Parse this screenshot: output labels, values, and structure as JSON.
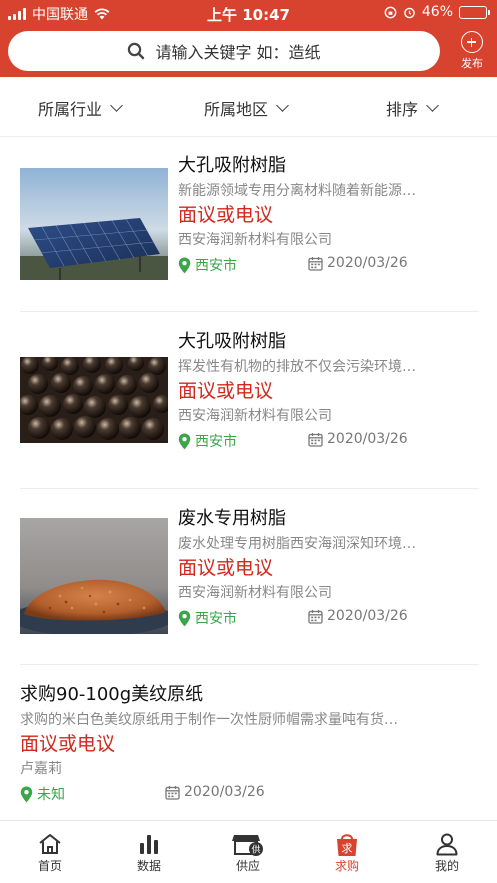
{
  "status_bar": {
    "carrier": "中国联通",
    "time": "上午 10:47",
    "battery": "46%"
  },
  "search": {
    "placeholder": "请输入关键字  如：造纸"
  },
  "publish_label": "发布",
  "filters": [
    {
      "label": "所属行业"
    },
    {
      "label": "所属地区"
    },
    {
      "label": "排序"
    }
  ],
  "listings": [
    {
      "title": "大孔吸附树脂",
      "description": "新能源领域专用分离材料随着新能源…",
      "price": "面议或电议",
      "company": "西安海润新材料有限公司",
      "location": "西安市",
      "date": "2020/03/26"
    },
    {
      "title": "大孔吸附树脂",
      "description": "挥发性有机物的排放不仅会污染环境…",
      "price": "面议或电议",
      "company": "西安海润新材料有限公司",
      "location": "西安市",
      "date": "2020/03/26"
    },
    {
      "title": "废水专用树脂",
      "description": "废水处理专用树脂西安海润深知环境…",
      "price": "面议或电议",
      "company": "西安海润新材料有限公司",
      "location": "西安市",
      "date": "2020/03/26"
    },
    {
      "title": "求购90-100g美纹原纸",
      "description": "求购的米白色美纹原纸用于制作一次性厨师帽需求量吨有货…",
      "price": "面议或电议",
      "company": "卢嘉莉",
      "location": "未知",
      "date": "2020/03/26"
    }
  ],
  "tabs": [
    {
      "label": "首页",
      "icon": "home-icon"
    },
    {
      "label": "数据",
      "icon": "bar-chart-icon"
    },
    {
      "label": "供应",
      "icon": "supply-store-icon"
    },
    {
      "label": "求购",
      "icon": "purchase-bag-icon",
      "active": true
    },
    {
      "label": "我的",
      "icon": "user-icon"
    }
  ],
  "colors": {
    "brand": "#d8432f",
    "price": "#d0281d",
    "location": "#3aa54a"
  }
}
